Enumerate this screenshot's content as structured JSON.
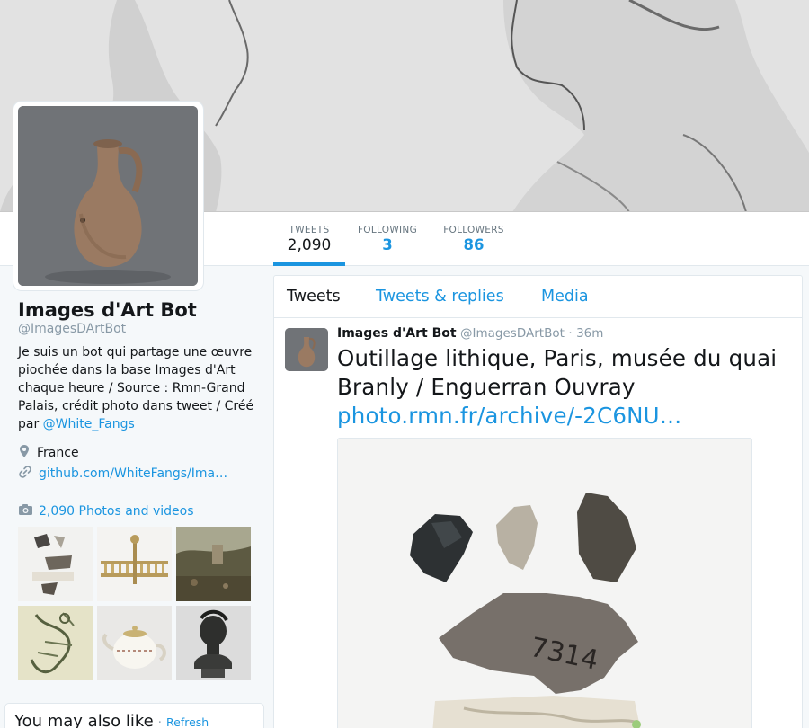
{
  "profile": {
    "name": "Images d'Art Bot",
    "handle": "@ImagesDArtBot",
    "bio_text": "Je suis un bot qui partage une œuvre piochée dans la base Images d'Art chaque heure / Source : Rmn-Grand Palais, crédit photo dans tweet / Créé par ",
    "bio_mention": "@White_Fangs",
    "location": "France",
    "website": "github.com/WhiteFangs/Ima…",
    "photos_label": "2,090 Photos and videos"
  },
  "stats": {
    "tweets_label": "TWEETS",
    "tweets_value": "2,090",
    "following_label": "FOLLOWING",
    "following_value": "3",
    "followers_label": "FOLLOWERS",
    "followers_value": "86"
  },
  "tabs": {
    "tweets": "Tweets",
    "replies": "Tweets & replies",
    "media": "Media"
  },
  "tweet": {
    "fullname": "Images d'Art Bot",
    "username": "@ImagesDArtBot",
    "separator": "·",
    "time": "36m",
    "text": "Outillage lithique, Paris, musée du quai Branly / Enguerran Ouvray",
    "link": "photo.rmn.fr/archive/-2C6NU…"
  },
  "sidebar": {
    "wtf_title": "You may also like",
    "wtf_separator": "·",
    "refresh": "Refresh"
  },
  "icons": {
    "location": "map-pin-icon",
    "link": "link-icon",
    "camera": "camera-icon"
  },
  "colors": {
    "accent": "#1b95e0",
    "text": "#14171a",
    "muted": "#8899a6"
  }
}
